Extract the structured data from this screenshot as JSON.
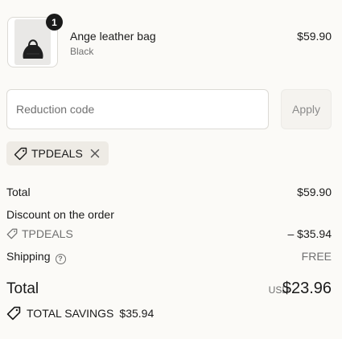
{
  "cart": {
    "item": {
      "quantity": "1",
      "name": "Ange leather bag",
      "variant": "Black",
      "price": "$59.90",
      "image_icon": "handbag-icon"
    }
  },
  "discount_form": {
    "placeholder": "Reduction code",
    "value": "",
    "apply_label": "Apply"
  },
  "applied_code": {
    "code": "TPDEALS",
    "tag_icon": "tag-icon",
    "remove_icon": "close-icon"
  },
  "summary": {
    "subtotal_label": "Total",
    "subtotal_value": "$59.90",
    "discount_label": "Discount on the order",
    "discount_code": "TPDEALS",
    "discount_value": "– $35.94",
    "shipping_label": "Shipping",
    "shipping_help_icon": "help-icon",
    "shipping_value": "FREE",
    "total_label": "Total",
    "currency": "USD",
    "total_value": "$23.96",
    "savings_label": "TOTAL SAVINGS",
    "savings_value": "$35.94"
  },
  "colors": {
    "background": "#fbfaf7",
    "text": "#1a1a1a",
    "muted": "#707070",
    "chip_bg": "#eeebe5"
  }
}
